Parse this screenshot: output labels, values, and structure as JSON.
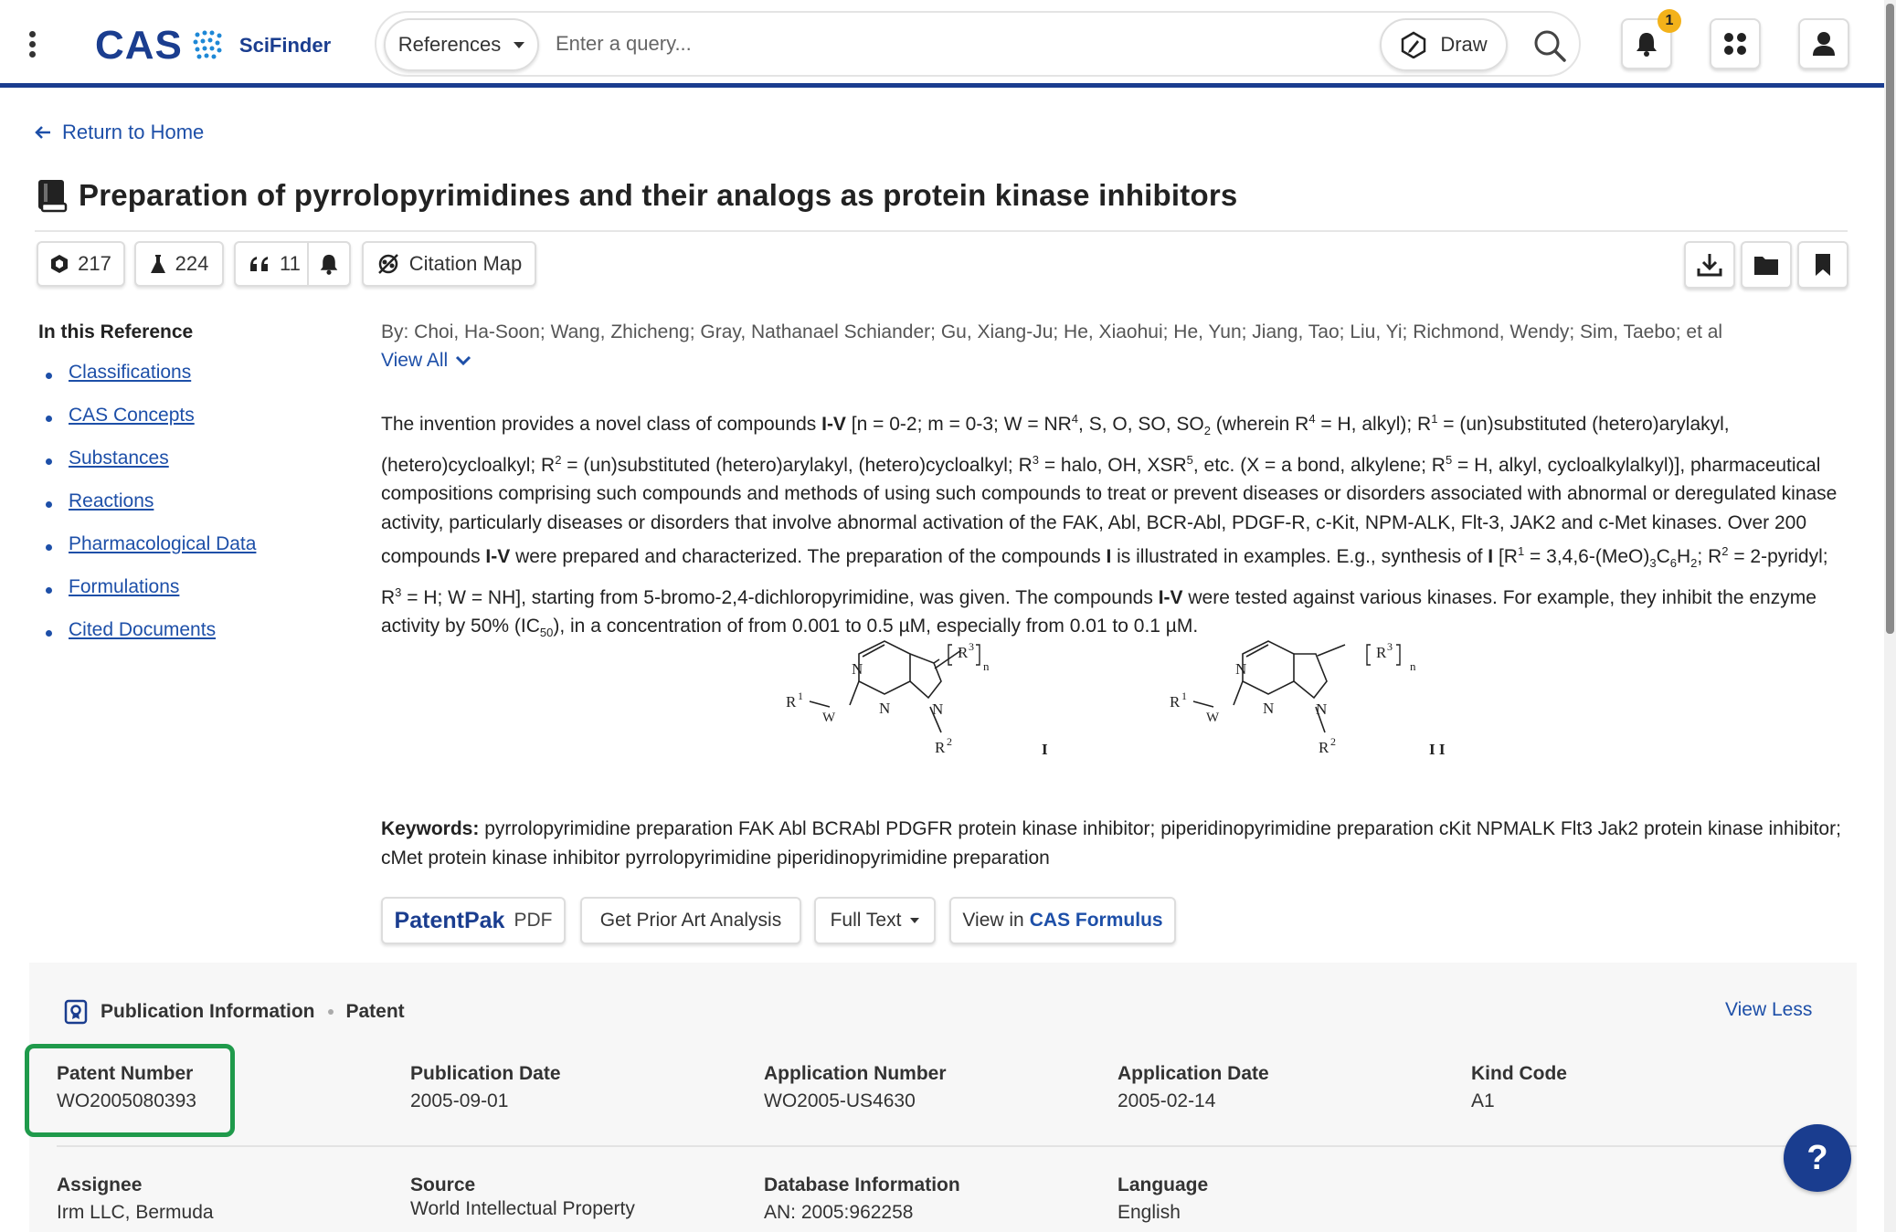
{
  "header": {
    "logo_cas": "CAS",
    "logo_product": "SciFinder",
    "search_type": "References",
    "search_placeholder": "Enter a query...",
    "draw_label": "Draw",
    "notification_count": "1"
  },
  "nav": {
    "return_label": "Return to Home"
  },
  "reference": {
    "title": "Preparation of pyrrolopyrimidines and their analogs as protein kinase inhibitors",
    "substances_count": "217",
    "reactions_count": "224",
    "citations_count": "11",
    "citation_map_label": "Citation Map",
    "authors": "By: Choi, Ha-Soon; Wang, Zhicheng; Gray, Nathanael Schiander; Gu, Xiang-Ju; He, Xiaohui; He, Yun; Jiang, Tao; Liu, Yi; Richmond, Wendy; Sim, Taebo; et al",
    "view_all_label": "View All",
    "keywords_label": "Keywords:",
    "keywords": "pyrrolopyrimidine preparation FAK Abl BCRAbl PDGFR protein kinase inhibitor; piperidinopyrimidine preparation cKit NPMALK Flt3 Jak2 protein kinase inhibitor; cMet protein kinase inhibitor pyrrolopyrimidine piperidinopyrimidine preparation"
  },
  "sidebar": {
    "title": "In this Reference",
    "items": [
      {
        "label": "Classifications"
      },
      {
        "label": "CAS Concepts"
      },
      {
        "label": "Substances"
      },
      {
        "label": "Reactions"
      },
      {
        "label": "Pharmacological Data"
      },
      {
        "label": "Formulations"
      },
      {
        "label": "Cited Documents"
      }
    ]
  },
  "structures": {
    "I": {
      "label": "I",
      "atoms": [
        "N",
        "N",
        "N",
        "R",
        "1",
        "W",
        "R",
        "2",
        "R",
        "3",
        "n"
      ]
    },
    "II": {
      "label": "I I",
      "atoms": [
        "N",
        "N",
        "N",
        "R",
        "1",
        "W",
        "R",
        "2",
        "R",
        "3",
        "n"
      ]
    }
  },
  "actions": {
    "patentpak": "PatentPak",
    "pdf": "PDF",
    "prior_art": "Get Prior Art Analysis",
    "full_text": "Full Text",
    "view_in": "View in",
    "formulus": "CAS Formulus"
  },
  "publication": {
    "heading": "Publication Information",
    "doc_type": "Patent",
    "view_less": "View Less",
    "patent_number_label": "Patent Number",
    "patent_number": "WO2005080393",
    "publication_date_label": "Publication Date",
    "publication_date": "2005-09-01",
    "application_number_label": "Application Number",
    "application_number": "WO2005-US4630",
    "application_date_label": "Application Date",
    "application_date": "2005-02-14",
    "kind_code_label": "Kind Code",
    "kind_code": "A1",
    "assignee_label": "Assignee",
    "assignee": "Irm LLC, Bermuda",
    "source_label": "Source",
    "source": "World Intellectual Property",
    "database_label": "Database Information",
    "database": "AN: 2005:962258",
    "language_label": "Language",
    "language": "English"
  },
  "help_label": "?",
  "colors": {
    "brand": "#1a3d8f",
    "link": "#1d4fa8",
    "highlight": "#1f9a4b",
    "badge": "#f3b21a"
  }
}
